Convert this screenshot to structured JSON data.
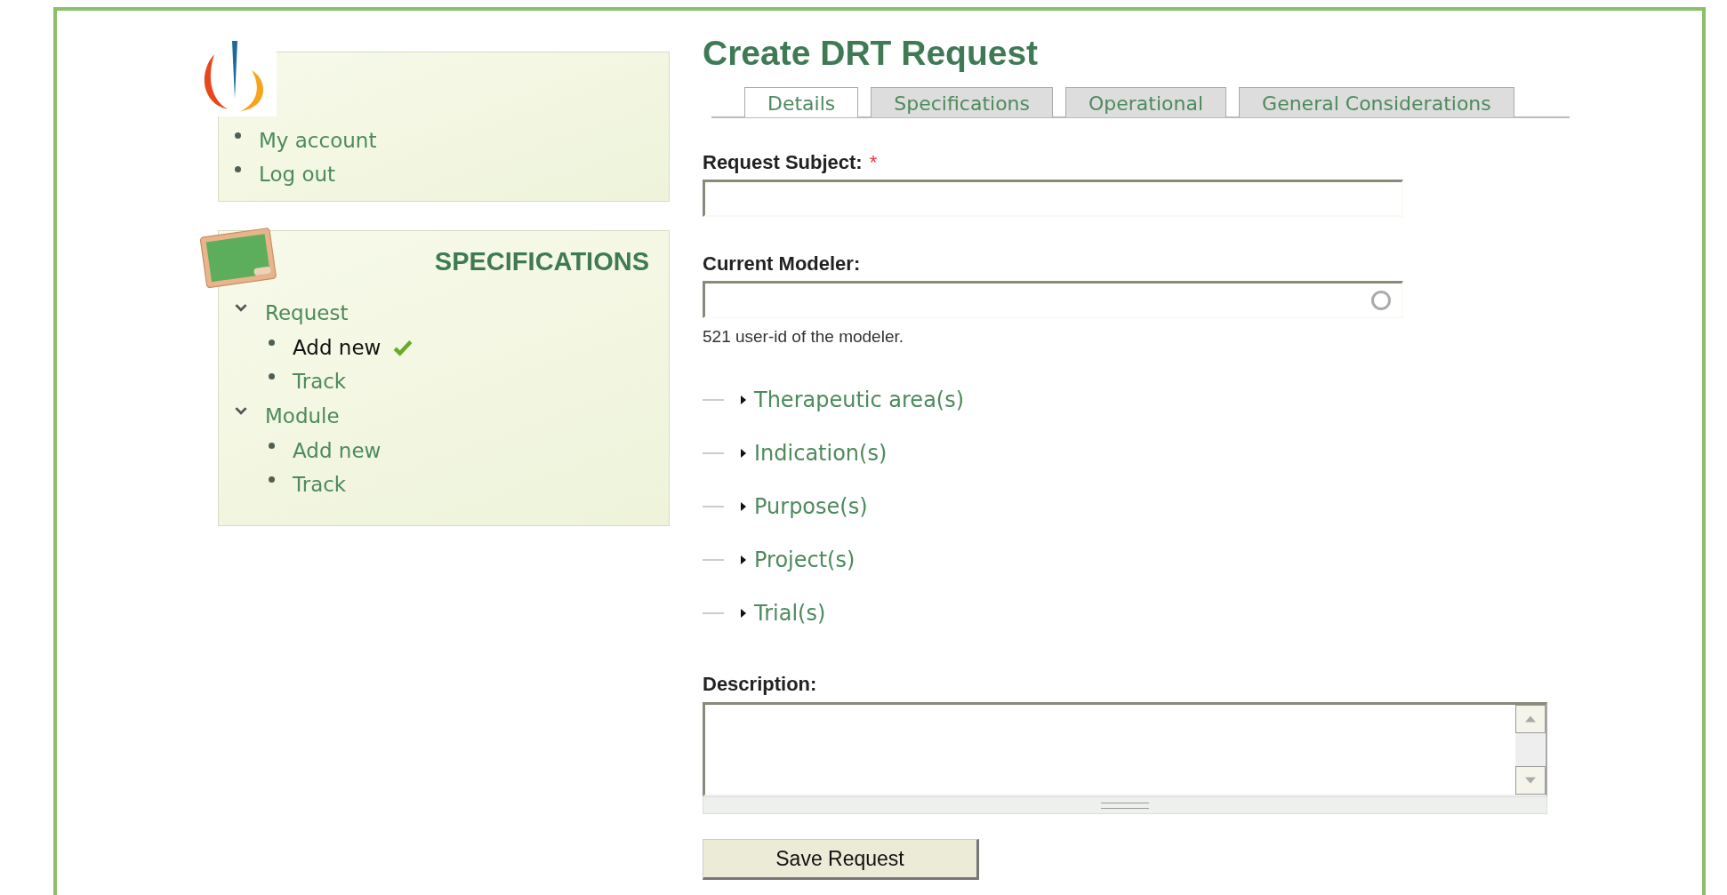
{
  "user_menu": [
    {
      "label": "My account"
    },
    {
      "label": "Log out"
    }
  ],
  "nav": {
    "title": "SPECIFICATIONS",
    "groups": [
      {
        "label": "Request",
        "expanded": true,
        "children": [
          {
            "label": "Add new",
            "selected": true
          },
          {
            "label": "Track",
            "selected": false
          }
        ]
      },
      {
        "label": "Module",
        "expanded": true,
        "children": [
          {
            "label": "Add new",
            "selected": false
          },
          {
            "label": "Track",
            "selected": false
          }
        ]
      }
    ]
  },
  "page_title": "Create DRT Request",
  "tabs": [
    {
      "label": "Details",
      "selected": true
    },
    {
      "label": "Specifications",
      "selected": false
    },
    {
      "label": "Operational",
      "selected": false
    },
    {
      "label": "General Considerations",
      "selected": false
    }
  ],
  "request_subject": {
    "label": "Request Subject:",
    "required": true,
    "required_mark": "*"
  },
  "current_modeler": {
    "label": "Current Modeler:",
    "help": "521 user-id of the modeler."
  },
  "sections": [
    {
      "label": "Therapeutic area(s)",
      "expanded": false
    },
    {
      "label": "Indication(s)",
      "expanded": false
    },
    {
      "label": "Purpose(s)",
      "expanded": false
    },
    {
      "label": "Project(s)",
      "expanded": false
    },
    {
      "label": "Trial(s)",
      "expanded": false
    }
  ],
  "description": {
    "label": "Description:"
  },
  "save_button": "Save Request"
}
